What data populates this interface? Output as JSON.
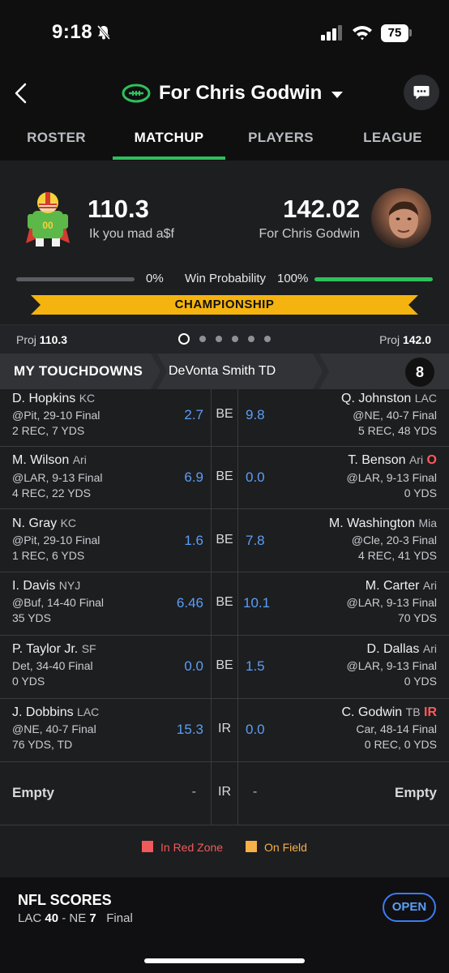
{
  "status_bar": {
    "time": "9:18",
    "battery": "75"
  },
  "header": {
    "title": "For Chris Godwin"
  },
  "tabs": [
    {
      "label": "ROSTER"
    },
    {
      "label": "MATCHUP"
    },
    {
      "label": "PLAYERS"
    },
    {
      "label": "LEAGUE"
    }
  ],
  "matchup": {
    "left": {
      "score": "110.3",
      "team_name": "Ik you mad a$f"
    },
    "right": {
      "score": "142.02",
      "team_name": "For Chris Godwin"
    },
    "win_probability": {
      "left": "0%",
      "label": "Win Probability",
      "right": "100%"
    },
    "round": "CHAMPIONSHIP",
    "proj_label": "Proj",
    "proj_left": "110.3",
    "proj_right": "142.0"
  },
  "banner": {
    "title": "MY TOUCHDOWNS",
    "subtitle": "DeVonta Smith TD",
    "count": "8"
  },
  "roster": [
    {
      "left": {
        "name": "D. Hopkins",
        "team": "KC",
        "game": "@Pit, 29-10 Final",
        "stat": "2 REC, 7 YDS",
        "pts": "2.7"
      },
      "slot": "BE",
      "right": {
        "name": "Q. Johnston",
        "team": "LAC",
        "tag": "",
        "game": "@NE, 40-7 Final",
        "stat": "5 REC, 48 YDS",
        "pts": "9.8"
      }
    },
    {
      "left": {
        "name": "M. Wilson",
        "team": "Ari",
        "game": "@LAR, 9-13 Final",
        "stat": "4 REC, 22 YDS",
        "pts": "6.9"
      },
      "slot": "BE",
      "right": {
        "name": "T. Benson",
        "team": "Ari",
        "tag": "O",
        "game": "@LAR, 9-13 Final",
        "stat": "0 YDS",
        "pts": "0.0"
      }
    },
    {
      "left": {
        "name": "N. Gray",
        "team": "KC",
        "game": "@Pit, 29-10 Final",
        "stat": "1 REC, 6 YDS",
        "pts": "1.6"
      },
      "slot": "BE",
      "right": {
        "name": "M. Washington",
        "team": "Mia",
        "tag": "",
        "game": "@Cle, 20-3 Final",
        "stat": "4 REC, 41 YDS",
        "pts": "7.8"
      }
    },
    {
      "left": {
        "name": "I. Davis",
        "team": "NYJ",
        "game": "@Buf, 14-40 Final",
        "stat": "35 YDS",
        "pts": "6.46"
      },
      "slot": "BE",
      "right": {
        "name": "M. Carter",
        "team": "Ari",
        "tag": "",
        "game": "@LAR, 9-13 Final",
        "stat": "70 YDS",
        "pts": "10.1"
      }
    },
    {
      "left": {
        "name": "P. Taylor Jr.",
        "team": "SF",
        "game": "Det, 34-40 Final",
        "stat": "0 YDS",
        "pts": "0.0"
      },
      "slot": "BE",
      "right": {
        "name": "D. Dallas",
        "team": "Ari",
        "tag": "",
        "game": "@LAR, 9-13 Final",
        "stat": "0 YDS",
        "pts": "1.5"
      }
    },
    {
      "left": {
        "name": "J. Dobbins",
        "team": "LAC",
        "game": "@NE, 40-7 Final",
        "stat": "76 YDS, TD",
        "pts": "15.3"
      },
      "slot": "IR",
      "right": {
        "name": "C. Godwin",
        "team": "TB",
        "tag": "IR",
        "game": "Car, 48-14 Final",
        "stat": "0 REC, 0 YDS",
        "pts": "0.0"
      }
    }
  ],
  "empty_row": {
    "left": "Empty",
    "left_pts": "-",
    "slot": "IR",
    "right_pts": "-",
    "right": "Empty"
  },
  "legend": {
    "red_zone": "In Red Zone",
    "on_field": "On Field"
  },
  "footer": {
    "title": "NFL SCORES",
    "team1": "LAC",
    "score1": "40",
    "sep": "-",
    "team2": "NE",
    "score2": "7",
    "status": "Final",
    "open_label": "OPEN"
  },
  "colors": {
    "accent_green": "#2fc05c",
    "points_blue": "#5b9ef7",
    "red_zone": "#f05a5a",
    "on_field": "#f5b04a",
    "championship": "#f5b30f"
  }
}
